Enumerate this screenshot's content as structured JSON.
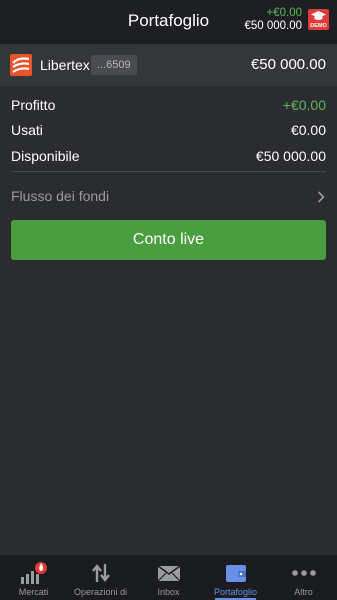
{
  "header": {
    "title": "Portafoglio",
    "profit": "+€0.00",
    "equity": "€50 000.00",
    "demo_badge": "DEMO"
  },
  "account": {
    "brand": "Libertex",
    "number": "...6509",
    "balance": "€50 000.00"
  },
  "summary": [
    {
      "label": "Profitto",
      "value": "+€0.00"
    },
    {
      "label": "Usati",
      "value": "€0.00"
    },
    {
      "label": "Disponibile",
      "value": "€50 000.00"
    }
  ],
  "funds_flow": {
    "label": "Flusso dei fondi"
  },
  "live_button": {
    "label": "Conto live"
  },
  "tabs": [
    {
      "label": "Mercati",
      "icon": "markets-fire-icon"
    },
    {
      "label": "Operazioni di",
      "icon": "arrows-updown-icon"
    },
    {
      "label": "Inbox",
      "icon": "envelope-icon"
    },
    {
      "label": "Portafoglio",
      "icon": "wallet-icon",
      "active": true
    },
    {
      "label": "Altro",
      "icon": "more-dots-icon"
    }
  ],
  "colors": {
    "background": "#2b2c30",
    "header": "#1e1f23",
    "positive": "#5cb85c",
    "button": "#4a9e3f",
    "active_tab": "#6a8fe8",
    "demo_badge": "#e03a3a",
    "brand_logo": "#e8552b"
  }
}
